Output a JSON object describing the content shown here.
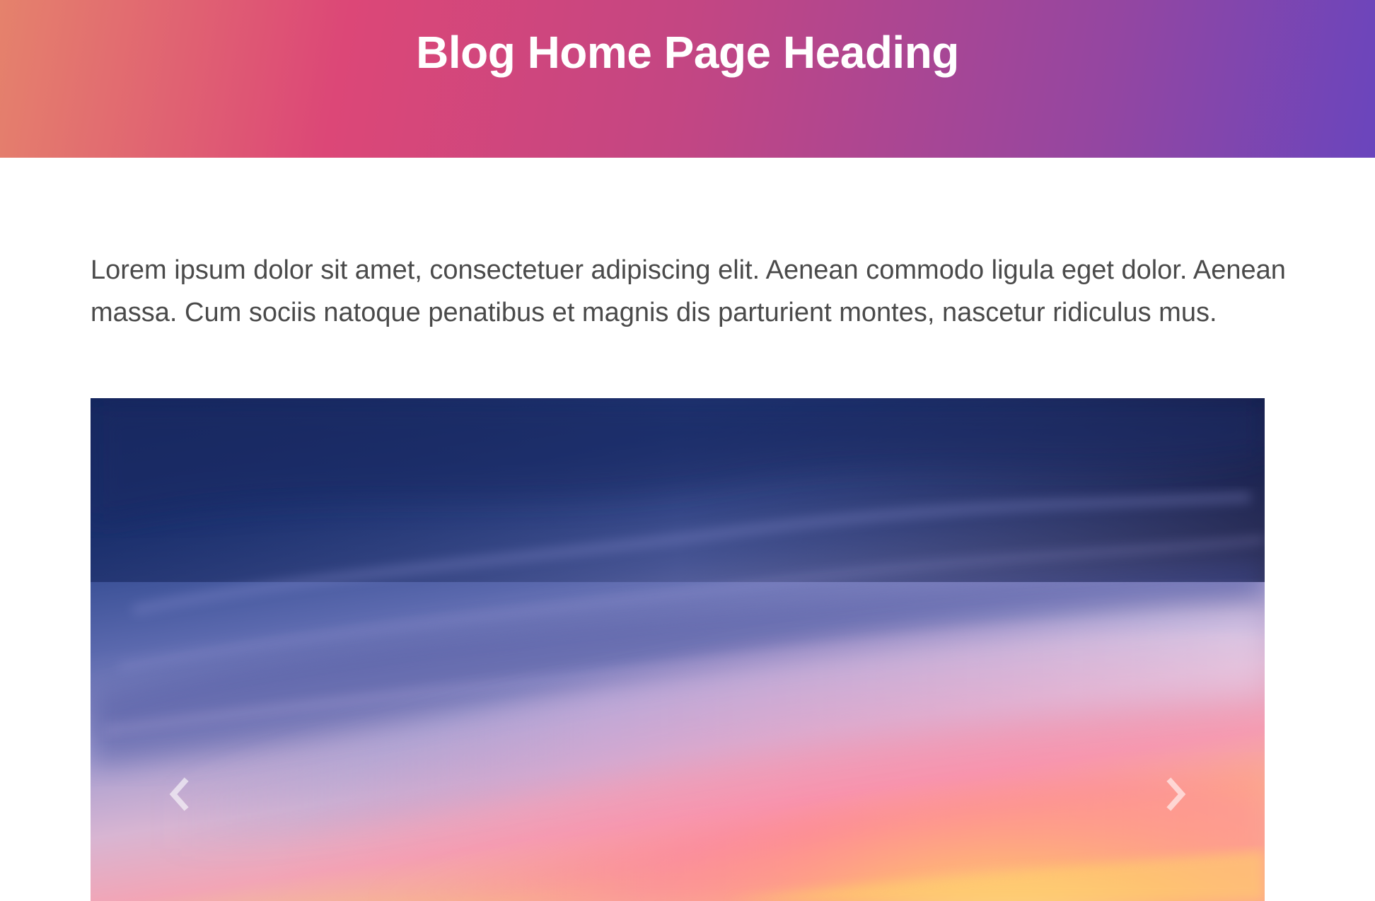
{
  "header": {
    "title": "Blog Home Page Heading",
    "gradient_colors": [
      "#e5826c",
      "#dc4777",
      "#c34683",
      "#9446a1",
      "#6a45bd"
    ]
  },
  "intro": {
    "text": "Lorem ipsum dolor sit amet, consectetuer adipiscing elit. Aenean commodo ligula eget dolor. Aenean massa. Cum sociis natoque penatibus et magnis dis parturient montes, nascetur ridiculus mus."
  },
  "carousel": {
    "prev_icon": "chevron-left-icon",
    "next_icon": "chevron-right-icon"
  },
  "colors": {
    "body_text": "#4a4a4a",
    "heading_text": "#ffffff"
  }
}
